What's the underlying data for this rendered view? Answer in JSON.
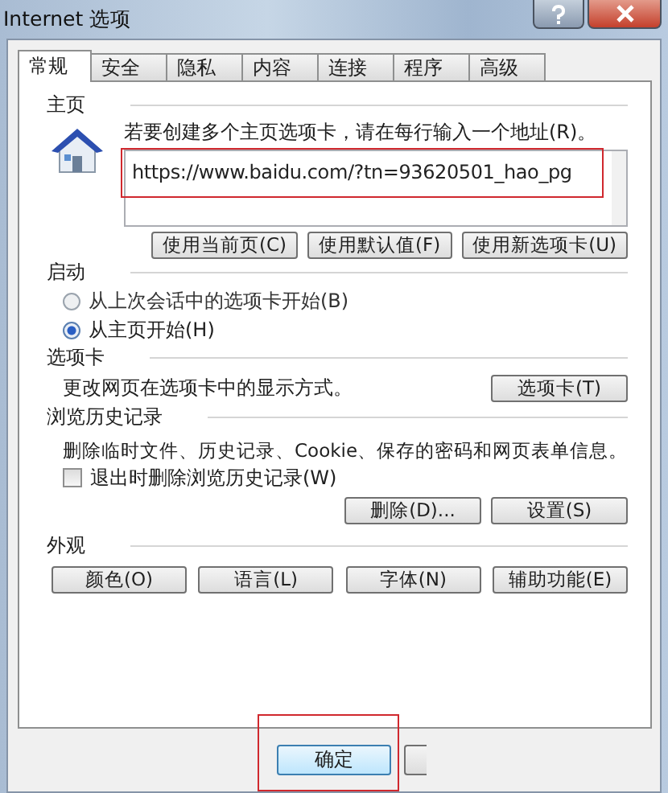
{
  "window": {
    "title": "Internet 选项"
  },
  "tabs": [
    {
      "label": "常规",
      "selected": true
    },
    {
      "label": "安全",
      "selected": false
    },
    {
      "label": "隐私",
      "selected": false
    },
    {
      "label": "内容",
      "selected": false
    },
    {
      "label": "连接",
      "selected": false
    },
    {
      "label": "程序",
      "selected": false
    },
    {
      "label": "高级",
      "selected": false
    }
  ],
  "home_page": {
    "heading": "主页",
    "instruction": "若要创建多个主页选项卡，请在每行输入一个地址(R)。",
    "url": "https://www.baidu.com/?tn=93620501_hao_pg",
    "annotated": true,
    "buttons": [
      "使用当前页(C)",
      "使用默认值(F)",
      "使用新选项卡(U)"
    ]
  },
  "startup": {
    "heading": "启动",
    "options": [
      {
        "label": "从上次会话中的选项卡开始(B)",
        "selected": false
      },
      {
        "label": "从主页开始(H)",
        "selected": true
      }
    ]
  },
  "tabs_section": {
    "heading": "选项卡",
    "description": "更改网页在选项卡中的显示方式。",
    "button": "选项卡(T)"
  },
  "browsing_history": {
    "heading": "浏览历史记录",
    "description": "删除临时文件、历史记录、Cookie、保存的密码和网页表单信息。",
    "checkbox": {
      "label": "退出时删除浏览历史记录(W)",
      "checked": false
    },
    "buttons": [
      "删除(D)...",
      "设置(S)"
    ]
  },
  "appearance": {
    "heading": "外观",
    "buttons": [
      "颜色(O)",
      "语言(L)",
      "字体(N)",
      "辅助功能(E)"
    ]
  },
  "footer": {
    "buttons": [
      {
        "label": "确定",
        "annotated": true
      }
    ]
  }
}
